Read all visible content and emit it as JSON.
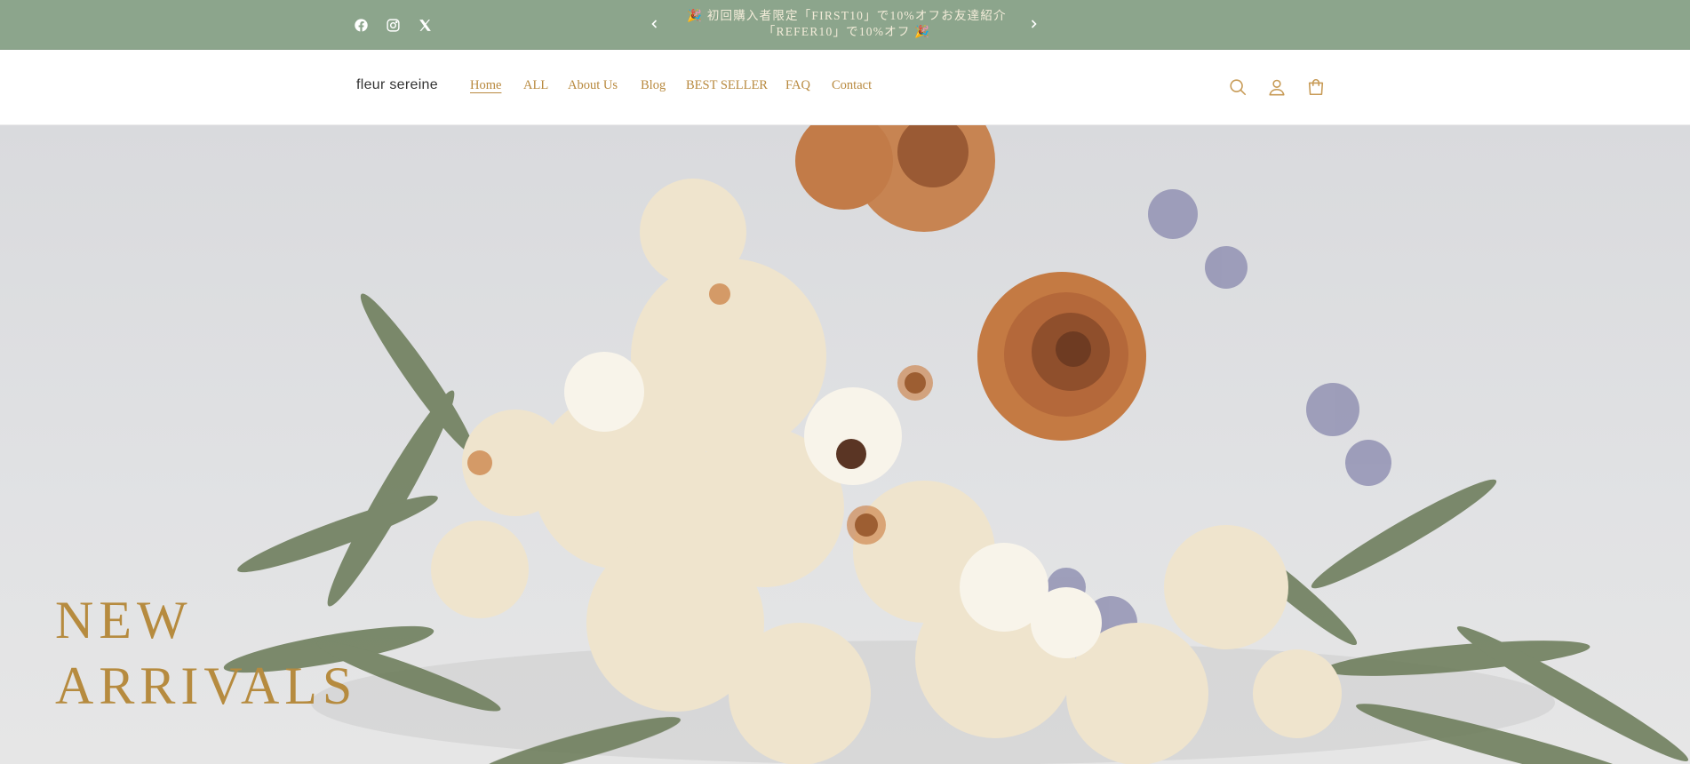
{
  "announcement": {
    "line1": "🎉 初回購入者限定「FIRST10」で10%オフお友達紹介",
    "line2": "「REFER10」で10%オフ 🎉",
    "social_icons": [
      "facebook-icon",
      "instagram-icon",
      "x-icon"
    ],
    "prev_icon": "chevron-left-icon",
    "next_icon": "chevron-right-icon"
  },
  "header": {
    "logo": "fleur sereine",
    "nav": [
      {
        "label": "Home",
        "active": true
      },
      {
        "label": "ALL",
        "active": false
      },
      {
        "label": "About Us",
        "active": false
      },
      {
        "label": "Blog",
        "active": false
      },
      {
        "label": "BEST SELLER",
        "active": false
      },
      {
        "label": "FAQ",
        "active": false
      },
      {
        "label": "Contact",
        "active": false
      }
    ],
    "icons": [
      "search-icon",
      "account-icon",
      "cart-icon"
    ]
  },
  "hero": {
    "title_line1": "NEW",
    "title_line2": "ARRIVALS"
  },
  "colors": {
    "announcement_bg": "#8ca58c",
    "accent": "#b8893e",
    "hero_bg": "#dcdde0"
  }
}
